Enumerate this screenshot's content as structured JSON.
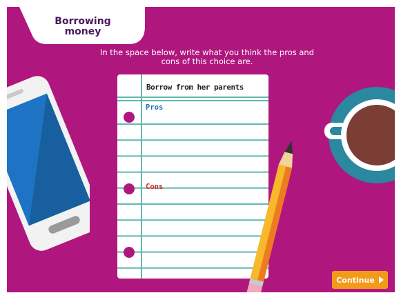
{
  "header": {
    "title": "Borrowing money"
  },
  "instructions": "In the space below, write what you think the pros and cons of this choice are.",
  "notepad": {
    "heading": "Borrow from her parents",
    "pros_label": "Pros",
    "cons_label": "Cons"
  },
  "continue_button": {
    "label": "Continue",
    "icon": "play-arrow-icon"
  },
  "colors": {
    "background": "#b0177e",
    "title_text": "#4a1a5c",
    "pros": "#1f6fbf",
    "cons": "#d12a2a",
    "button": "#f39a1b",
    "lines": "#5fb8b0"
  }
}
